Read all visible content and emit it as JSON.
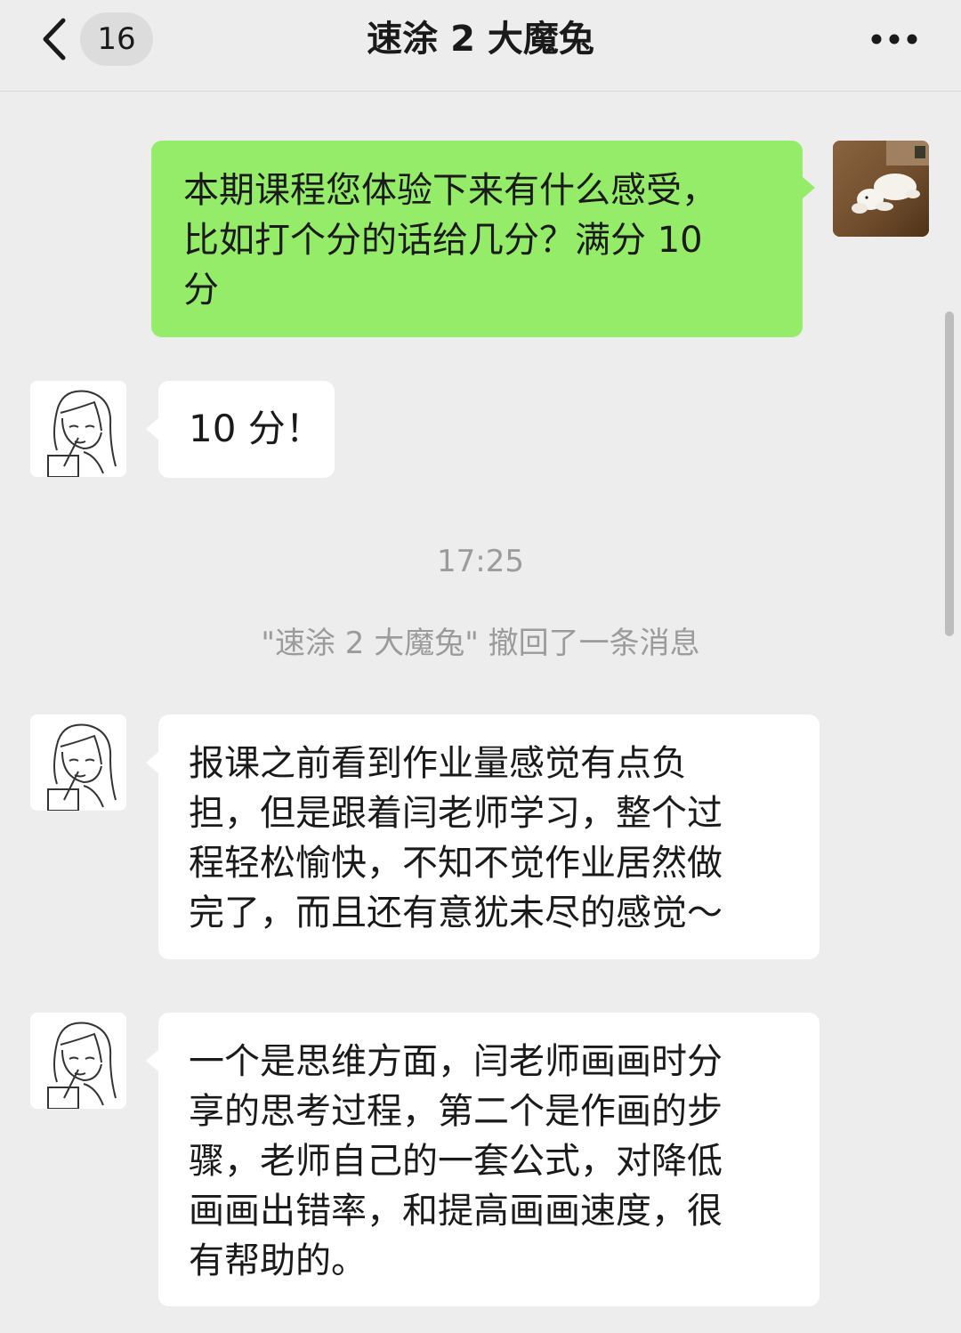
{
  "header": {
    "unread_count": "16",
    "title": "速涂 2 大魔兔",
    "back_icon": "chevron-left-icon",
    "more_icon": "ellipsis-icon"
  },
  "colors": {
    "background": "#ededed",
    "sent_bubble": "#95ec69",
    "received_bubble": "#ffffff",
    "system_text": "#9b9b9b"
  },
  "messages": [
    {
      "side": "sent",
      "lines": [
        "本期课程您体验下来有什么感受，",
        "比如打个分的话给几分？满分 10",
        "分"
      ]
    },
    {
      "side": "received",
      "lines": [
        "10 分！"
      ]
    },
    {
      "side": "received",
      "lines": [
        "报课之前看到作业量感觉有点负",
        "担，但是跟着闫老师学习，整个过",
        "程轻松愉快，不知不觉作业居然做",
        "完了，而且还有意犹未尽的感觉～"
      ]
    },
    {
      "side": "received",
      "lines": [
        "一个是思维方面，闫老师画画时分",
        "享的思考过程，第二个是作画的步",
        "骤，老师自己的一套公式，对降低",
        "画画出错率，和提高画画速度，很",
        "有帮助的。"
      ]
    }
  ],
  "system": {
    "timestamp": "17:25",
    "recall_notice": "\"速涂 2 大魔兔\" 撤回了一条消息"
  }
}
